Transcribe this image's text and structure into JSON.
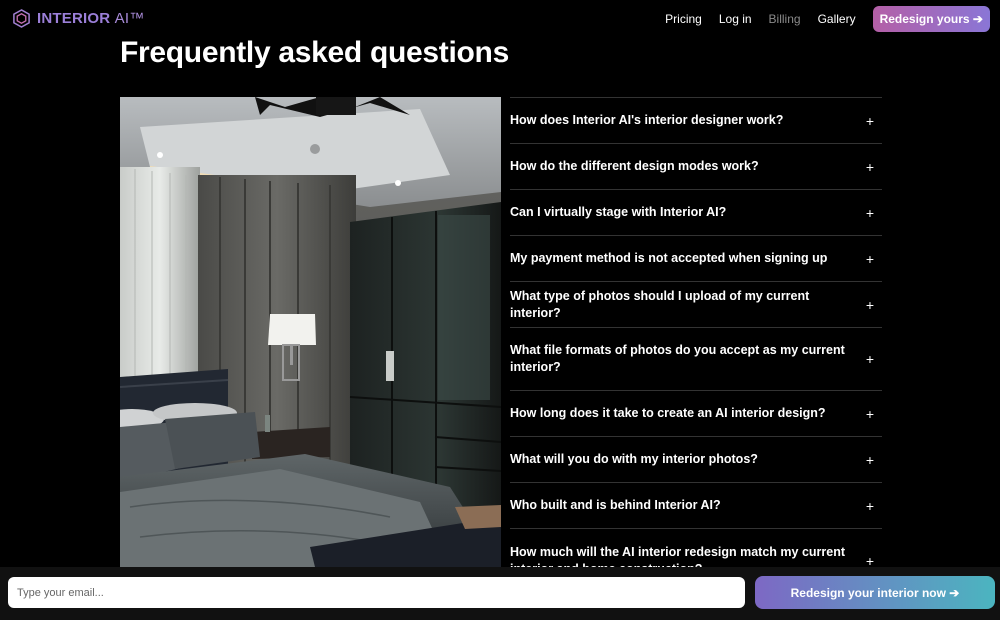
{
  "header": {
    "logo_text": "INTERIOR",
    "logo_suffix": "AI™",
    "nav": {
      "pricing": "Pricing",
      "login": "Log in",
      "billing": "Billing",
      "gallery": "Gallery",
      "cta": "Redesign yours ➔"
    }
  },
  "title": "Frequently asked questions",
  "faq": [
    {
      "question": "How does Interior AI's interior designer work?"
    },
    {
      "question": "How do the different design modes work?"
    },
    {
      "question": "Can I virtually stage with Interior AI?"
    },
    {
      "question": "My payment method is not accepted when signing up"
    },
    {
      "question": "What type of photos should I upload of my current interior?"
    },
    {
      "question": "What file formats of photos do you accept as my current interior?"
    },
    {
      "question": "How long does it take to create an AI interior design?"
    },
    {
      "question": "What will you do with my interior photos?"
    },
    {
      "question": "Who built and is behind Interior AI?"
    },
    {
      "question": "How much will the AI interior redesign match my current interior and home construction?"
    }
  ],
  "expand_symbol": "+",
  "bottom_bar": {
    "email_placeholder": "Type your email...",
    "cta": "Redesign your interior now ➔"
  },
  "colors": {
    "background": "#000000",
    "logo": "#9b7fd8",
    "nav_cta_gradient": [
      "#b45fa6",
      "#8a76d6"
    ],
    "bottom_cta_gradient": [
      "#7d68c4",
      "#4bb5c0"
    ]
  }
}
